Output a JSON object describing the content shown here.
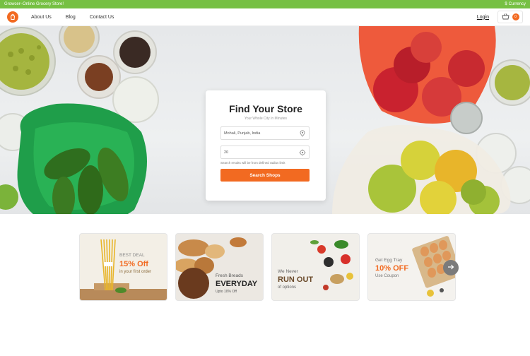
{
  "topbar": {
    "store_name": "Growcer–Online Grocery Store!",
    "currency_label": "Currency",
    "currency_symbol": "$"
  },
  "header": {
    "nav": [
      {
        "label": "About Us"
      },
      {
        "label": "Blog"
      },
      {
        "label": "Contact Us"
      }
    ],
    "login_label": "Login",
    "cart_count": "0"
  },
  "search_card": {
    "title": "Find Your Store",
    "subtitle": "Your Whole City In Minutes",
    "location_value": "Mohali, Punjab, India",
    "radius_value": "20",
    "hint": "Search results will be from defined radius limit",
    "button_label": "Search Shops"
  },
  "promos": [
    {
      "line1": "BEST DEAL",
      "line2": "15% Off",
      "line3": "in your first order"
    },
    {
      "line1": "Fresh Breads",
      "line2": "EVERYDAY",
      "line3": "Upto 10% Off"
    },
    {
      "line1": "We Never",
      "line2": "RUN OUT",
      "line3": "of options"
    },
    {
      "line1": "Get Egg Tray",
      "line2": "10% OFF",
      "line3": "Use Coupon"
    }
  ],
  "colors": {
    "accent": "#f26a21",
    "topbar": "#76c043"
  },
  "icons": {
    "logo": "bag-logo-icon",
    "cart": "basket-icon",
    "location": "location-pin-icon",
    "radius": "target-icon",
    "next": "arrow-right-icon"
  }
}
